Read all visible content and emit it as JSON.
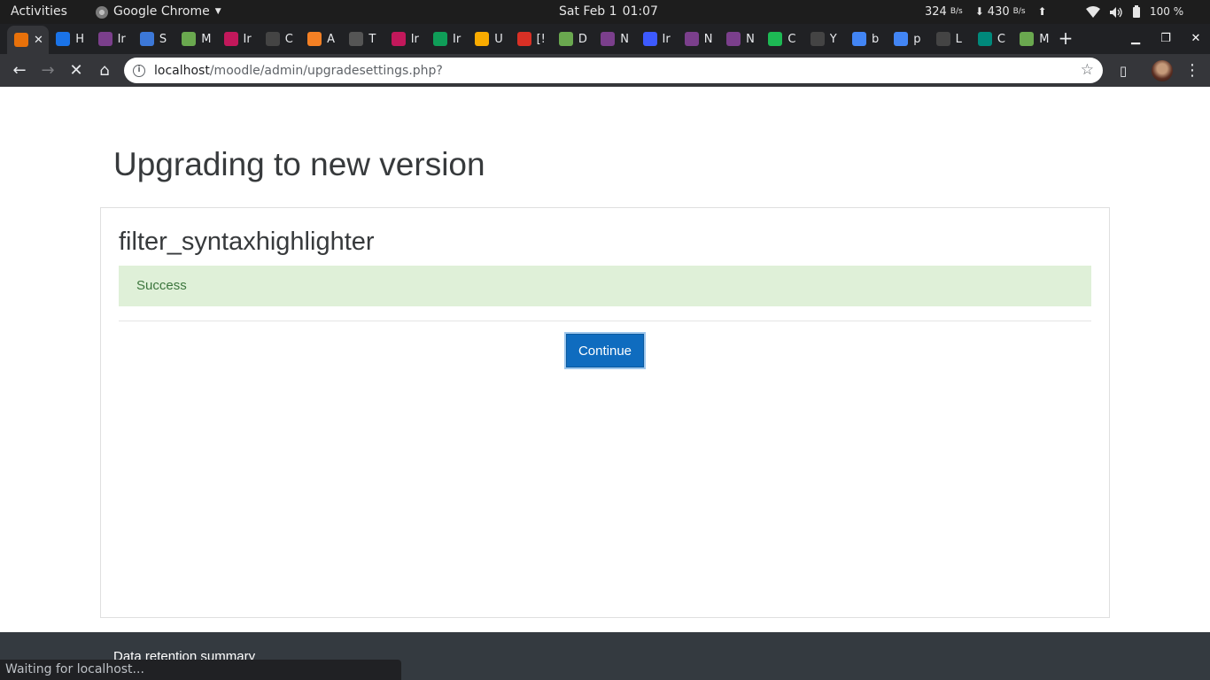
{
  "system_bar": {
    "activities": "Activities",
    "app_name": "Google Chrome",
    "date": "Sat Feb 1",
    "time": "01:07",
    "net_up_value": "324",
    "net_down_value": "430",
    "net_unit": "B/s",
    "battery": "100 %"
  },
  "browser": {
    "tabs": [
      {
        "title": "✕",
        "icon": "moodle-loading-icon",
        "color": "#e8710a",
        "active": true
      },
      {
        "title": "H",
        "icon": "swirl-icon",
        "color": "#1a73e8"
      },
      {
        "title": "Ir",
        "icon": "moodle-icon",
        "color": "#7b3f8c"
      },
      {
        "title": "S",
        "icon": "chat-icon",
        "color": "#3c78d8"
      },
      {
        "title": "M",
        "icon": "moodle-icon",
        "color": "#6aa84f"
      },
      {
        "title": "Ir",
        "icon": "cap-icon",
        "color": "#c2185b"
      },
      {
        "title": "C",
        "icon": "github-icon",
        "color": "#444"
      },
      {
        "title": "A",
        "icon": "stackoverflow-icon",
        "color": "#f48024"
      },
      {
        "title": "T",
        "icon": "note-icon",
        "color": "#555"
      },
      {
        "title": "Ir",
        "icon": "cap-icon",
        "color": "#c2185b"
      },
      {
        "title": "Ir",
        "icon": "tree-icon",
        "color": "#0f9d58"
      },
      {
        "title": "U",
        "icon": "bulb-icon",
        "color": "#f9ab00"
      },
      {
        "title": "[!",
        "icon": "a-icon",
        "color": "#d93025"
      },
      {
        "title": "D",
        "icon": "moodle-icon",
        "color": "#6aa84f"
      },
      {
        "title": "N",
        "icon": "moodle-icon",
        "color": "#7b3f8c"
      },
      {
        "title": "Ir",
        "icon": "moodle-icon",
        "color": "#3d5afe"
      },
      {
        "title": "N",
        "icon": "moodle-icon",
        "color": "#7b3f8c"
      },
      {
        "title": "N",
        "icon": "moodle-icon",
        "color": "#7b3f8c"
      },
      {
        "title": "C",
        "icon": "spotify-icon",
        "color": "#1db954"
      },
      {
        "title": "Y",
        "icon": "github-icon",
        "color": "#444"
      },
      {
        "title": "b",
        "icon": "google-icon",
        "color": "#4285f4"
      },
      {
        "title": "p",
        "icon": "google-icon",
        "color": "#4285f4"
      },
      {
        "title": "L",
        "icon": "github-icon",
        "color": "#444"
      },
      {
        "title": "C",
        "icon": "code-icon",
        "color": "#00897b"
      },
      {
        "title": "M",
        "icon": "moodle-icon",
        "color": "#6aa84f"
      }
    ],
    "new_tab": "+",
    "url_host": "localhost",
    "url_path": "/moodle/admin/upgradesettings.php?",
    "status": "Waiting for localhost..."
  },
  "page": {
    "heading": "Upgrading to new version",
    "plugin_name": "filter_syntaxhighlighter",
    "alert": "Success",
    "continue": "Continue",
    "footer_link": "Data retention summary"
  },
  "colors": {
    "primary": "#0f6cbf",
    "success_bg": "#dff0d8",
    "success_text": "#3c763d",
    "footer_bg": "#343a40"
  }
}
